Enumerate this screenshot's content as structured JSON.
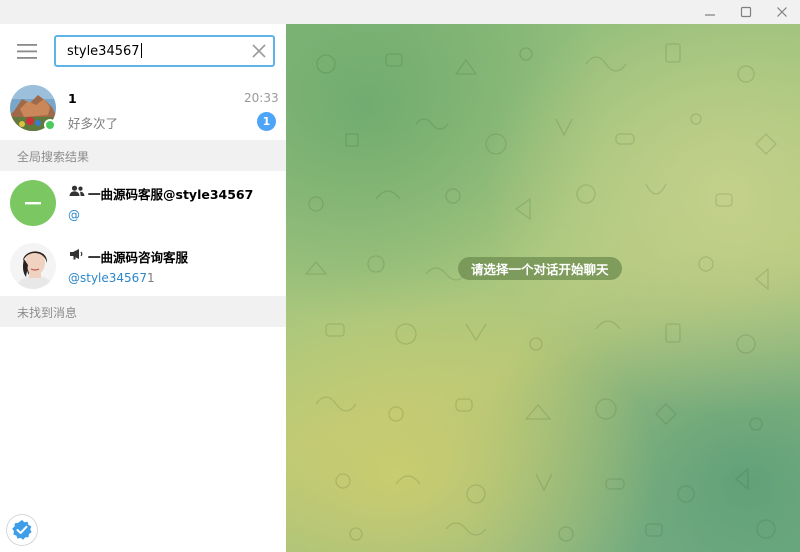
{
  "window": {
    "controls": [
      "minimize-icon",
      "maximize-icon",
      "close-icon"
    ]
  },
  "search": {
    "value": "style34567"
  },
  "chats": [
    {
      "title": "1",
      "time": "20:33",
      "last_message": "好多次了",
      "unread": "1",
      "online": true
    }
  ],
  "global_section": {
    "header": "全局搜索结果",
    "results": [
      {
        "kind": "group",
        "icon": "group-icon",
        "title": "一曲源码客服@style34567",
        "subtitle": "@",
        "avatar_letter": "一",
        "avatar_color": "#7bc862"
      },
      {
        "kind": "channel",
        "icon": "megaphone-icon",
        "title": "一曲源码咨询客服",
        "subtitle_main": "@style34567",
        "subtitle_tail": "1"
      }
    ]
  },
  "messages_section": {
    "header": "未找到消息"
  },
  "chat_area": {
    "empty_text": "请选择一个对话开始聊天"
  },
  "colors": {
    "accent": "#5eb5e5",
    "badge": "#4ea4f6",
    "online": "#4bcb5b",
    "link": "#2a87c9"
  }
}
